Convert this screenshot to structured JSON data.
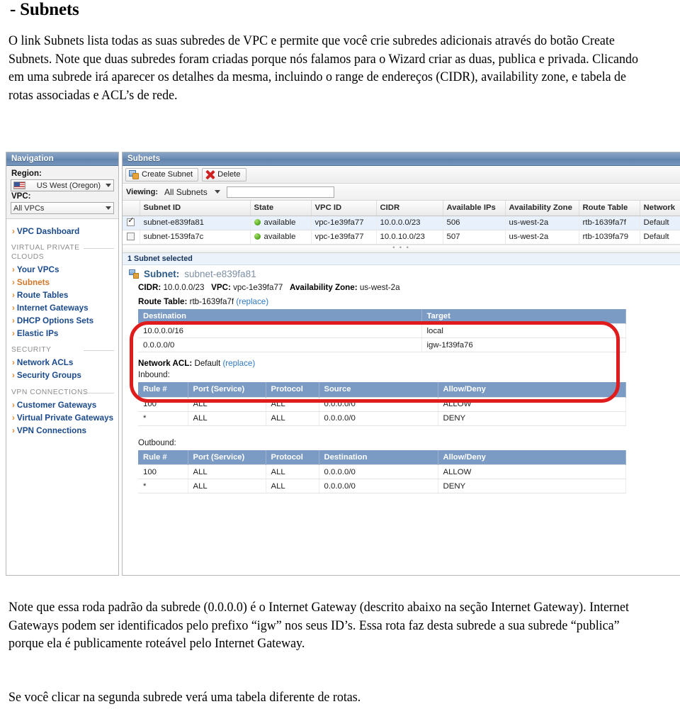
{
  "document": {
    "title": "- Subnets",
    "intro": "O link Subnets lista todas as suas subredes de VPC e permite que você crie subredes adicionais através do botão Create Subnets. Note que duas subredes foram criadas porque nós falamos para o Wizard criar as duas, publica e privada.  Clicando em uma subrede irá aparecer os detalhes da mesma, incluindo o range de endereços (CIDR), availability zone, e tabela de rotas associadas e ACL’s de rede.",
    "note_1": "Note que essa roda padrão da subrede (0.0.0.0) é o Internet Gateway (descrito abaixo na seção Internet Gateway).  Internet Gateways podem ser identificados pelo prefixo “igw” nos seus ID’s. Essa rota faz desta subrede a sua subrede “publica” porque ela é publicamente roteável pelo Internet Gateway.",
    "note_2": "Se você clicar na segunda subrede verá uma tabela diferente de rotas."
  },
  "navigation": {
    "header": "Navigation",
    "region_label": "Region:",
    "region_value": "US West (Oregon)",
    "vpc_label": "VPC:",
    "vpc_value": "All VPCs",
    "dashboard": "VPC Dashboard",
    "sections": [
      {
        "title": "VIRTUAL PRIVATE CLOUDS",
        "items": [
          {
            "label": "Your VPCs",
            "active": false
          },
          {
            "label": "Subnets",
            "active": true
          },
          {
            "label": "Route Tables",
            "active": false
          },
          {
            "label": "Internet Gateways",
            "active": false
          },
          {
            "label": "DHCP Options Sets",
            "active": false
          },
          {
            "label": "Elastic IPs",
            "active": false
          }
        ]
      },
      {
        "title": "SECURITY",
        "items": [
          {
            "label": "Network ACLs",
            "active": false
          },
          {
            "label": "Security Groups",
            "active": false
          }
        ]
      },
      {
        "title": "VPN CONNECTIONS",
        "items": [
          {
            "label": "Customer Gateways",
            "active": false
          },
          {
            "label": "Virtual Private Gateways",
            "active": false
          },
          {
            "label": "VPN Connections",
            "active": false
          }
        ]
      }
    ]
  },
  "subnets_panel": {
    "header": "Subnets",
    "toolbar": {
      "create_label": "Create Subnet",
      "delete_label": "Delete"
    },
    "viewing": {
      "label": "Viewing:",
      "filter_value": "All Subnets",
      "search_value": ""
    },
    "table": {
      "columns": [
        "Subnet ID",
        "State",
        "VPC ID",
        "CIDR",
        "Available IPs",
        "Availability Zone",
        "Route Table",
        "Network"
      ],
      "rows": [
        {
          "selected": true,
          "subnet_id": "subnet-e839fa81",
          "state": "available",
          "vpc_id": "vpc-1e39fa77",
          "cidr": "10.0.0.0/23",
          "available_ips": "506",
          "availability_zone": "us-west-2a",
          "route_table": "rtb-1639fa7f",
          "network": "Default"
        },
        {
          "selected": false,
          "subnet_id": "subnet-1539fa7c",
          "state": "available",
          "vpc_id": "vpc-1e39fa77",
          "cidr": "10.0.10.0/23",
          "available_ips": "507",
          "availability_zone": "us-west-2a",
          "route_table": "rtb-1039fa79",
          "network": "Default"
        }
      ]
    },
    "selection_status": "1 Subnet selected",
    "detail": {
      "subnet_label": "Subnet:",
      "subnet_value": "subnet-e839fa81",
      "cidr_label": "CIDR:",
      "cidr_value": "10.0.0.0/23",
      "vpc_label": "VPC:",
      "vpc_value": "vpc-1e39fa77",
      "az_label": "Availability Zone:",
      "az_value": "us-west-2a",
      "route_table": {
        "label": "Route Table:",
        "value": "rtb-1639fa7f",
        "replace_link": "(replace)",
        "columns": [
          "Destination",
          "Target"
        ],
        "rows": [
          {
            "destination": "10.0.0.0/16",
            "target": "local"
          },
          {
            "destination": "0.0.0.0/0",
            "target": "igw-1f39fa76"
          }
        ]
      },
      "network_acl": {
        "label": "Network ACL:",
        "value": "Default",
        "replace_link": "(replace)",
        "inbound_label": "Inbound:",
        "outbound_label": "Outbound:",
        "inbound_columns": [
          "Rule #",
          "Port (Service)",
          "Protocol",
          "Source",
          "Allow/Deny"
        ],
        "inbound_rows": [
          {
            "rule": "100",
            "port": "ALL",
            "protocol": "ALL",
            "cidr": "0.0.0.0/0",
            "action": "ALLOW"
          },
          {
            "rule": "*",
            "port": "ALL",
            "protocol": "ALL",
            "cidr": "0.0.0.0/0",
            "action": "DENY"
          }
        ],
        "outbound_columns": [
          "Rule #",
          "Port (Service)",
          "Protocol",
          "Destination",
          "Allow/Deny"
        ],
        "outbound_rows": [
          {
            "rule": "100",
            "port": "ALL",
            "protocol": "ALL",
            "cidr": "0.0.0.0/0",
            "action": "ALLOW"
          },
          {
            "rule": "*",
            "port": "ALL",
            "protocol": "ALL",
            "cidr": "0.0.0.0/0",
            "action": "DENY"
          }
        ]
      }
    }
  },
  "annotation": {
    "highlight_color": "#e01b1b",
    "header_blue": "#7b9ac4",
    "link_blue": "#1b4a8c",
    "active_orange": "#d2762a"
  }
}
